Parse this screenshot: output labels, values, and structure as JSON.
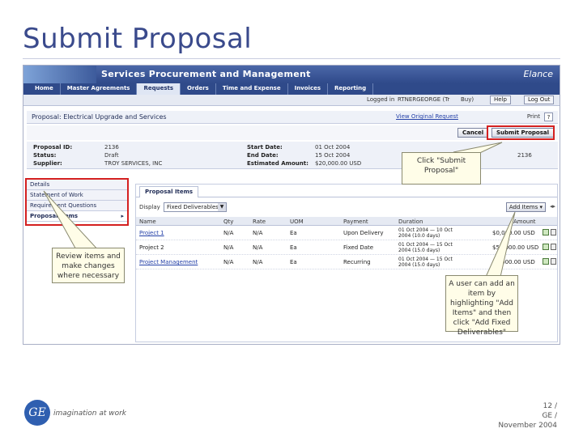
{
  "slide": {
    "title": "Submit Proposal",
    "footer_page": "12 /",
    "footer_org": "GE /",
    "footer_date": "November 2004",
    "logo_text": "GE",
    "logo_tagline": "imagination at work"
  },
  "app": {
    "banner_title": "Services Procurement and Management",
    "banner_logo": "Elance",
    "nav_tabs": [
      "Home",
      "Master Agreements",
      "Requests",
      "Orders",
      "Time and Expense",
      "Invoices",
      "Reporting"
    ],
    "active_tab": "Requests",
    "userbar": {
      "logged_in": "Logged in",
      "user": "RTNERGEORGE (Tr",
      "role": "Buy)",
      "help": "Help",
      "logout": "Log Out"
    },
    "proposal_title": "Proposal: Electrical Upgrade and Services",
    "view_link": "View Original Request",
    "print": "Print",
    "help_icon": "?",
    "cancel_label": "Cancel",
    "submit_label": "Submit Proposal",
    "summary": {
      "proposal_id_label": "Proposal ID:",
      "proposal_id": "2136",
      "status_label": "Status:",
      "status": "Draft",
      "supplier_label": "Supplier:",
      "supplier": "TROY SERVICES, INC",
      "start_label": "Start Date:",
      "start": "01 Oct 2004",
      "end_label": "End Date:",
      "end": "15 Oct 2004",
      "amount_label": "Estimated Amount:",
      "amount": "$20,000.00 USD",
      "right_val": "2136"
    },
    "sidebar": [
      "Details",
      "Statement of Work",
      "Requirement Questions",
      "Proposal Items"
    ],
    "sidebar_active_marker": "▸",
    "items_tab": "Proposal Items",
    "display_label": "Display",
    "display_value": "Fixed Deliverables",
    "add_items": "Add Items",
    "table_headers": [
      "Name",
      "Qty",
      "Rate",
      "UOM",
      "Payment",
      "Duration",
      "Amount"
    ],
    "rows": [
      {
        "name": "Project 1",
        "qty": "N/A",
        "rate": "N/A",
        "uom": "Ea",
        "payment": "Upon Delivery",
        "duration": "01 Oct 2004 — 10 Oct 2004 (10.0 days)",
        "amount": "$0,000.00 USD"
      },
      {
        "name": "Project 2",
        "qty": "N/A",
        "rate": "N/A",
        "uom": "Ea",
        "payment": "Fixed Date",
        "duration": "01 Oct 2004 — 15 Oct 2004 (15.0 days)",
        "amount": "$50,000.00 USD"
      },
      {
        "name": "Project Management",
        "qty": "N/A",
        "rate": "N/A",
        "uom": "Ea",
        "payment": "Recurring",
        "duration": "01 Oct 2004 — 15 Oct 2004 (15.0 days)",
        "amount": "$5,000.00 USD"
      }
    ]
  },
  "callouts": {
    "submit": "Click \"Submit Proposal\"",
    "review": "Review items and make changes where necessary",
    "add": "A user can add an item by highlighting \"Add Items\" and then click \"Add Fixed Deliverables\""
  }
}
